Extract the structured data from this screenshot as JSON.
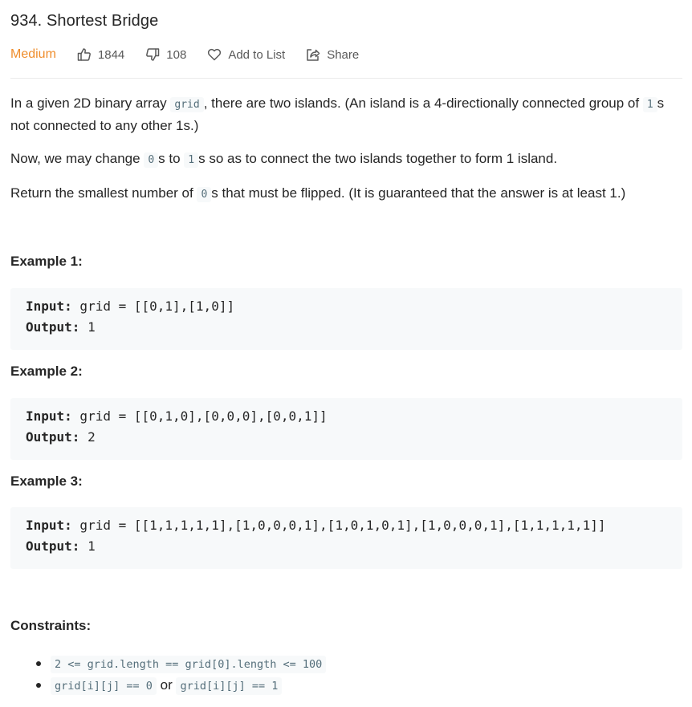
{
  "problem": {
    "title": "934. Shortest Bridge",
    "difficulty": "Medium",
    "likes": "1844",
    "dislikes": "108",
    "add_to_list_label": "Add to List",
    "share_label": "Share",
    "difficulty_color": "#ef8d2c"
  },
  "description": {
    "p1": {
      "t1": "In a given 2D binary array ",
      "c1": "grid",
      "t2": ", there are two islands.  (An island is a 4-directionally connected group of ",
      "c2": "1",
      "t3": "s not connected to any other 1s.)"
    },
    "p2": {
      "t1": "Now, we may change ",
      "c1": "0",
      "t2": "s to ",
      "c2": "1",
      "t3": "s so as to connect the two islands together to form 1 island."
    },
    "p3": {
      "t1": "Return the smallest number of ",
      "c1": "0",
      "t2": "s that must be flipped.  (It is guaranteed that the answer is at least 1.)"
    }
  },
  "examples": [
    {
      "title": "Example 1:",
      "input_label": "Input:",
      "input_value": " grid = [[0,1],[1,0]]",
      "output_label": "Output:",
      "output_value": " 1"
    },
    {
      "title": "Example 2:",
      "input_label": "Input:",
      "input_value": " grid = [[0,1,0],[0,0,0],[0,0,1]]",
      "output_label": "Output:",
      "output_value": " 2"
    },
    {
      "title": "Example 3:",
      "input_label": "Input:",
      "input_value": " grid = [[1,1,1,1,1],[1,0,0,0,1],[1,0,1,0,1],[1,0,0,0,1],[1,1,1,1,1]]",
      "output_label": "Output:",
      "output_value": " 1"
    }
  ],
  "constraints": {
    "title": "Constraints:",
    "item1": "2 <= grid.length == grid[0].length <= 100",
    "item2": {
      "c1": "grid[i][j] == 0",
      "t1": " or ",
      "c2": "grid[i][j] == 1"
    }
  },
  "icons": {
    "like": "thumbs-up-icon",
    "dislike": "thumbs-down-icon",
    "add_to_list": "heart-icon",
    "share": "share-icon"
  }
}
